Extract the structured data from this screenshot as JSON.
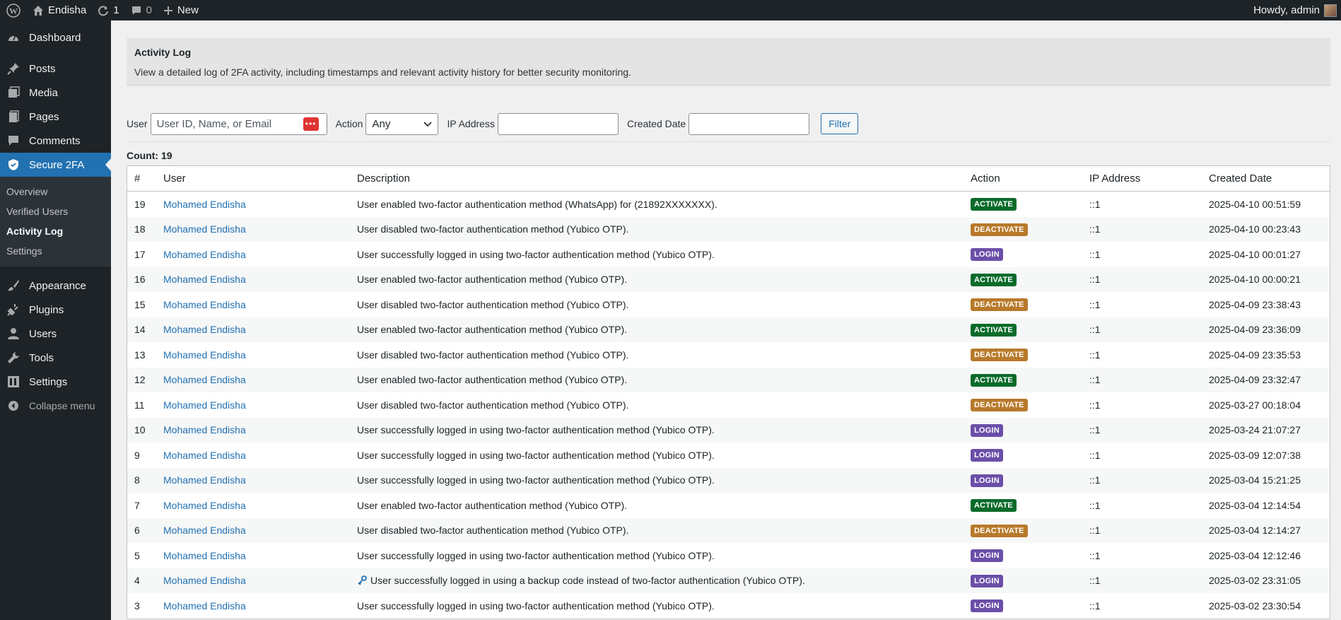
{
  "adminbar": {
    "site_name": "Endisha",
    "updates_count": "1",
    "comments_count": "0",
    "new_label": "New",
    "greeting": "Howdy, admin"
  },
  "sidebar": {
    "items": [
      {
        "label": "Dashboard",
        "icon": "dashboard-icon"
      },
      {
        "label": "Posts",
        "icon": "pushpin-icon"
      },
      {
        "label": "Media",
        "icon": "media-icon"
      },
      {
        "label": "Pages",
        "icon": "pages-icon"
      },
      {
        "label": "Comments",
        "icon": "comment-icon"
      },
      {
        "label": "Secure 2FA",
        "icon": "shield-icon"
      }
    ],
    "submenu": [
      "Overview",
      "Verified Users",
      "Activity Log",
      "Settings"
    ],
    "items2": [
      {
        "label": "Appearance",
        "icon": "brush-icon"
      },
      {
        "label": "Plugins",
        "icon": "plug-icon"
      },
      {
        "label": "Users",
        "icon": "users-icon"
      },
      {
        "label": "Tools",
        "icon": "wrench-icon"
      },
      {
        "label": "Settings",
        "icon": "settings-icon"
      }
    ],
    "collapse_label": "Collapse menu"
  },
  "header": {
    "title": "Activity Log",
    "description": "View a detailed log of 2FA activity, including timestamps and relevant activity history for better security monitoring."
  },
  "filters": {
    "user_label": "User",
    "user_placeholder": "User ID, Name, or Email",
    "action_label": "Action",
    "action_value": "Any",
    "ip_label": "IP Address",
    "date_label": "Created Date",
    "filter_button": "Filter"
  },
  "count_text": "Count: 19",
  "table": {
    "columns": [
      "#",
      "User",
      "Description",
      "Action",
      "IP Address",
      "Created Date"
    ],
    "rows": [
      {
        "num": "19",
        "user": "Mohamed Endisha",
        "desc": "User enabled two-factor authentication method (WhatsApp) for (21892XXXXXXX).",
        "action": "ACTIVATE",
        "ip": "::1",
        "date": "2025-04-10 00:51:59"
      },
      {
        "num": "18",
        "user": "Mohamed Endisha",
        "desc": "User disabled two-factor authentication method (Yubico OTP).",
        "action": "DEACTIVATE",
        "ip": "::1",
        "date": "2025-04-10 00:23:43"
      },
      {
        "num": "17",
        "user": "Mohamed Endisha",
        "desc": "User successfully logged in using two-factor authentication method (Yubico OTP).",
        "action": "LOGIN",
        "ip": "::1",
        "date": "2025-04-10 00:01:27"
      },
      {
        "num": "16",
        "user": "Mohamed Endisha",
        "desc": "User enabled two-factor authentication method (Yubico OTP).",
        "action": "ACTIVATE",
        "ip": "::1",
        "date": "2025-04-10 00:00:21"
      },
      {
        "num": "15",
        "user": "Mohamed Endisha",
        "desc": "User disabled two-factor authentication method (Yubico OTP).",
        "action": "DEACTIVATE",
        "ip": "::1",
        "date": "2025-04-09 23:38:43"
      },
      {
        "num": "14",
        "user": "Mohamed Endisha",
        "desc": "User enabled two-factor authentication method (Yubico OTP).",
        "action": "ACTIVATE",
        "ip": "::1",
        "date": "2025-04-09 23:36:09"
      },
      {
        "num": "13",
        "user": "Mohamed Endisha",
        "desc": "User disabled two-factor authentication method (Yubico OTP).",
        "action": "DEACTIVATE",
        "ip": "::1",
        "date": "2025-04-09 23:35:53"
      },
      {
        "num": "12",
        "user": "Mohamed Endisha",
        "desc": "User enabled two-factor authentication method (Yubico OTP).",
        "action": "ACTIVATE",
        "ip": "::1",
        "date": "2025-04-09 23:32:47"
      },
      {
        "num": "11",
        "user": "Mohamed Endisha",
        "desc": "User disabled two-factor authentication method (Yubico OTP).",
        "action": "DEACTIVATE",
        "ip": "::1",
        "date": "2025-03-27 00:18:04"
      },
      {
        "num": "10",
        "user": "Mohamed Endisha",
        "desc": "User successfully logged in using two-factor authentication method (Yubico OTP).",
        "action": "LOGIN",
        "ip": "::1",
        "date": "2025-03-24 21:07:27"
      },
      {
        "num": "9",
        "user": "Mohamed Endisha",
        "desc": "User successfully logged in using two-factor authentication method (Yubico OTP).",
        "action": "LOGIN",
        "ip": "::1",
        "date": "2025-03-09 12:07:38"
      },
      {
        "num": "8",
        "user": "Mohamed Endisha",
        "desc": "User successfully logged in using two-factor authentication method (Yubico OTP).",
        "action": "LOGIN",
        "ip": "::1",
        "date": "2025-03-04 15:21:25"
      },
      {
        "num": "7",
        "user": "Mohamed Endisha",
        "desc": "User enabled two-factor authentication method (Yubico OTP).",
        "action": "ACTIVATE",
        "ip": "::1",
        "date": "2025-03-04 12:14:54"
      },
      {
        "num": "6",
        "user": "Mohamed Endisha",
        "desc": "User disabled two-factor authentication method (Yubico OTP).",
        "action": "DEACTIVATE",
        "ip": "::1",
        "date": "2025-03-04 12:14:27"
      },
      {
        "num": "5",
        "user": "Mohamed Endisha",
        "desc": "User successfully logged in using two-factor authentication method (Yubico OTP).",
        "action": "LOGIN",
        "ip": "::1",
        "date": "2025-03-04 12:12:46"
      },
      {
        "num": "4",
        "user": "Mohamed Endisha",
        "desc": "User successfully logged in using a backup code instead of two-factor authentication (Yubico OTP).",
        "action": "LOGIN",
        "ip": "::1",
        "date": "2025-03-02 23:31:05",
        "key_icon": true
      },
      {
        "num": "3",
        "user": "Mohamed Endisha",
        "desc": "User successfully logged in using two-factor authentication method (Yubico OTP).",
        "action": "LOGIN",
        "ip": "::1",
        "date": "2025-03-02 23:30:54"
      }
    ]
  },
  "colors": {
    "ACTIVATE": "#0a6b2a",
    "DEACTIVATE": "#b8792a",
    "LOGIN": "#6b4fa8",
    "accent": "#2271b1"
  }
}
